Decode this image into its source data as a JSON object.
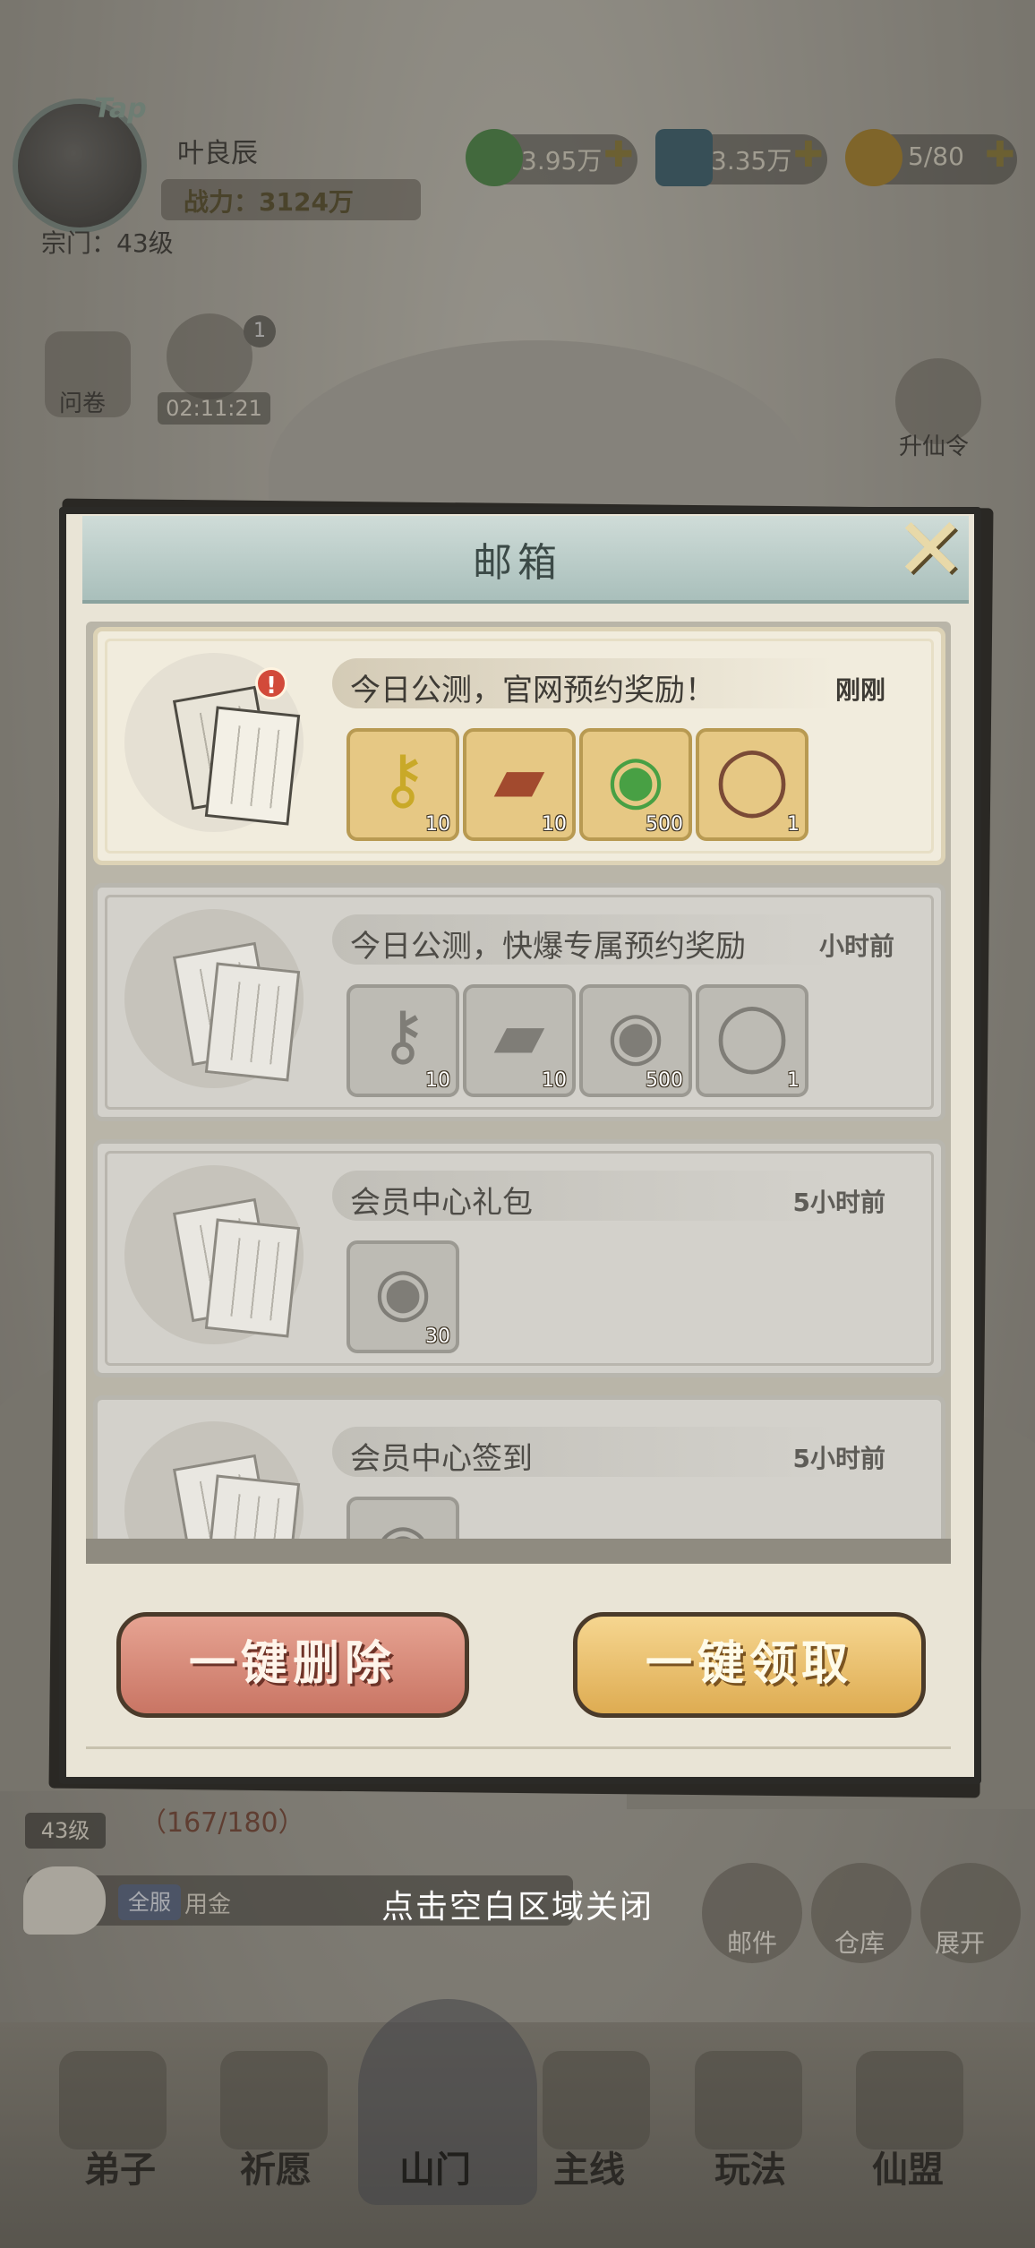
{
  "hud": {
    "tap_label": "Tap",
    "player_name": "叶良辰",
    "power": "战力：3124万",
    "sect": "宗门：43级",
    "resources": [
      {
        "icon": "jade-icon",
        "value": "3.95万"
      },
      {
        "icon": "crystal-icon",
        "value": "3.35万"
      },
      {
        "icon": "stamina-icon",
        "value": "5/80"
      }
    ]
  },
  "side": {
    "survey_label": "问卷",
    "gift_timer": "02:11:21",
    "gift_count": "1",
    "ascend_label": "升仙令"
  },
  "modal": {
    "title": "邮箱",
    "mails": [
      {
        "title": "今日公测，官网预约奖励！",
        "time": "刚刚",
        "unread": true,
        "items": [
          {
            "icon": "key-icon",
            "glyph": "⚷",
            "qty": "10"
          },
          {
            "icon": "ticket-icon",
            "glyph": "▰",
            "qty": "10"
          },
          {
            "icon": "jade-dragon-icon",
            "glyph": "◉",
            "qty": "500"
          },
          {
            "icon": "ring-icon",
            "glyph": "◯",
            "qty": "1"
          }
        ]
      },
      {
        "title": "今日公测，快爆专属预约奖励",
        "time": "小时前",
        "unread": false,
        "items": [
          {
            "icon": "key-icon",
            "glyph": "⚷",
            "qty": "10"
          },
          {
            "icon": "ticket-icon",
            "glyph": "▰",
            "qty": "10"
          },
          {
            "icon": "jade-dragon-icon",
            "glyph": "◉",
            "qty": "500"
          },
          {
            "icon": "ring-icon",
            "glyph": "◯",
            "qty": "1"
          }
        ]
      },
      {
        "title": "会员中心礼包",
        "time": "5小时前",
        "unread": false,
        "items": [
          {
            "icon": "jade-dragon-icon",
            "glyph": "◉",
            "qty": "30"
          }
        ]
      },
      {
        "title": "会员中心签到",
        "time": "5小时前",
        "unread": false,
        "items": [
          {
            "icon": "jade-dragon-icon",
            "glyph": "◉",
            "qty": ""
          }
        ]
      }
    ],
    "delete_all": "一键删除",
    "claim_all": "一键领取"
  },
  "bottom": {
    "level": "43级",
    "progress": "（167/180）",
    "chat_tag": "全服",
    "chat_text": "用金",
    "close_hint": "点击空白区域关闭",
    "quick": [
      "邮件",
      "仓库",
      "展开"
    ],
    "nav": [
      "弟子",
      "祈愿",
      "山门",
      "主线",
      "玩法",
      "仙盟"
    ]
  }
}
